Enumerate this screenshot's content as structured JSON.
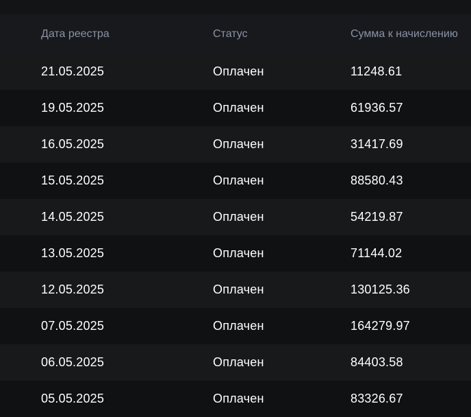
{
  "table": {
    "columns": [
      "Дата реестра",
      "Статус",
      "Сумма к начислению"
    ],
    "rows": [
      {
        "date": "21.05.2025",
        "status": "Оплачен",
        "amount": "11248.61"
      },
      {
        "date": "19.05.2025",
        "status": "Оплачен",
        "amount": "61936.57"
      },
      {
        "date": "16.05.2025",
        "status": "Оплачен",
        "amount": "31417.69"
      },
      {
        "date": "15.05.2025",
        "status": "Оплачен",
        "amount": "88580.43"
      },
      {
        "date": "14.05.2025",
        "status": "Оплачен",
        "amount": "54219.87"
      },
      {
        "date": "13.05.2025",
        "status": "Оплачен",
        "amount": "71144.02"
      },
      {
        "date": "12.05.2025",
        "status": "Оплачен",
        "amount": "130125.36"
      },
      {
        "date": "07.05.2025",
        "status": "Оплачен",
        "amount": "164279.97"
      },
      {
        "date": "06.05.2025",
        "status": "Оплачен",
        "amount": "84403.58"
      },
      {
        "date": "05.05.2025",
        "status": "Оплачен",
        "amount": "83326.67"
      }
    ]
  },
  "colors": {
    "background": "#131416",
    "header_background": "#18191c",
    "row_odd": "#18191b",
    "row_even": "#101112",
    "header_text": "#8a93a6",
    "cell_text": "#ffffff"
  }
}
